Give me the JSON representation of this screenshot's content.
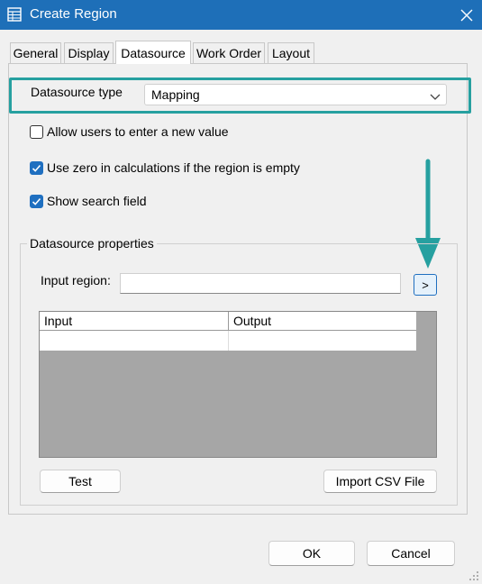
{
  "window": {
    "title": "Create Region"
  },
  "colors": {
    "accent": "#1f6fc0",
    "highlight": "#26a0a0",
    "titlebar": "#1e6fb8"
  },
  "tabs": [
    {
      "label": "General",
      "active": false
    },
    {
      "label": "Display",
      "active": false
    },
    {
      "label": "Datasource",
      "active": true
    },
    {
      "label": "Work Order",
      "active": false
    },
    {
      "label": "Layout",
      "active": false
    }
  ],
  "datasource_type": {
    "label": "Datasource type",
    "value": "Mapping"
  },
  "options": [
    {
      "label": "Allow users to enter a new value",
      "checked": false
    },
    {
      "label": "Use zero in calculations if the region is empty",
      "checked": true
    },
    {
      "label": "Show search field",
      "checked": true
    }
  ],
  "properties": {
    "title": "Datasource properties",
    "input_region_label": "Input region:",
    "input_region_value": "",
    "browse_label": ">",
    "grid": {
      "columns": [
        "Input",
        "Output"
      ]
    },
    "test_label": "Test",
    "import_label": "Import CSV File"
  },
  "footer": {
    "ok_label": "OK",
    "cancel_label": "Cancel"
  },
  "icons": {
    "app": "table-icon",
    "close": "close-icon",
    "arrow": "arrow-down-icon",
    "chevron": "chevron-down-icon"
  }
}
